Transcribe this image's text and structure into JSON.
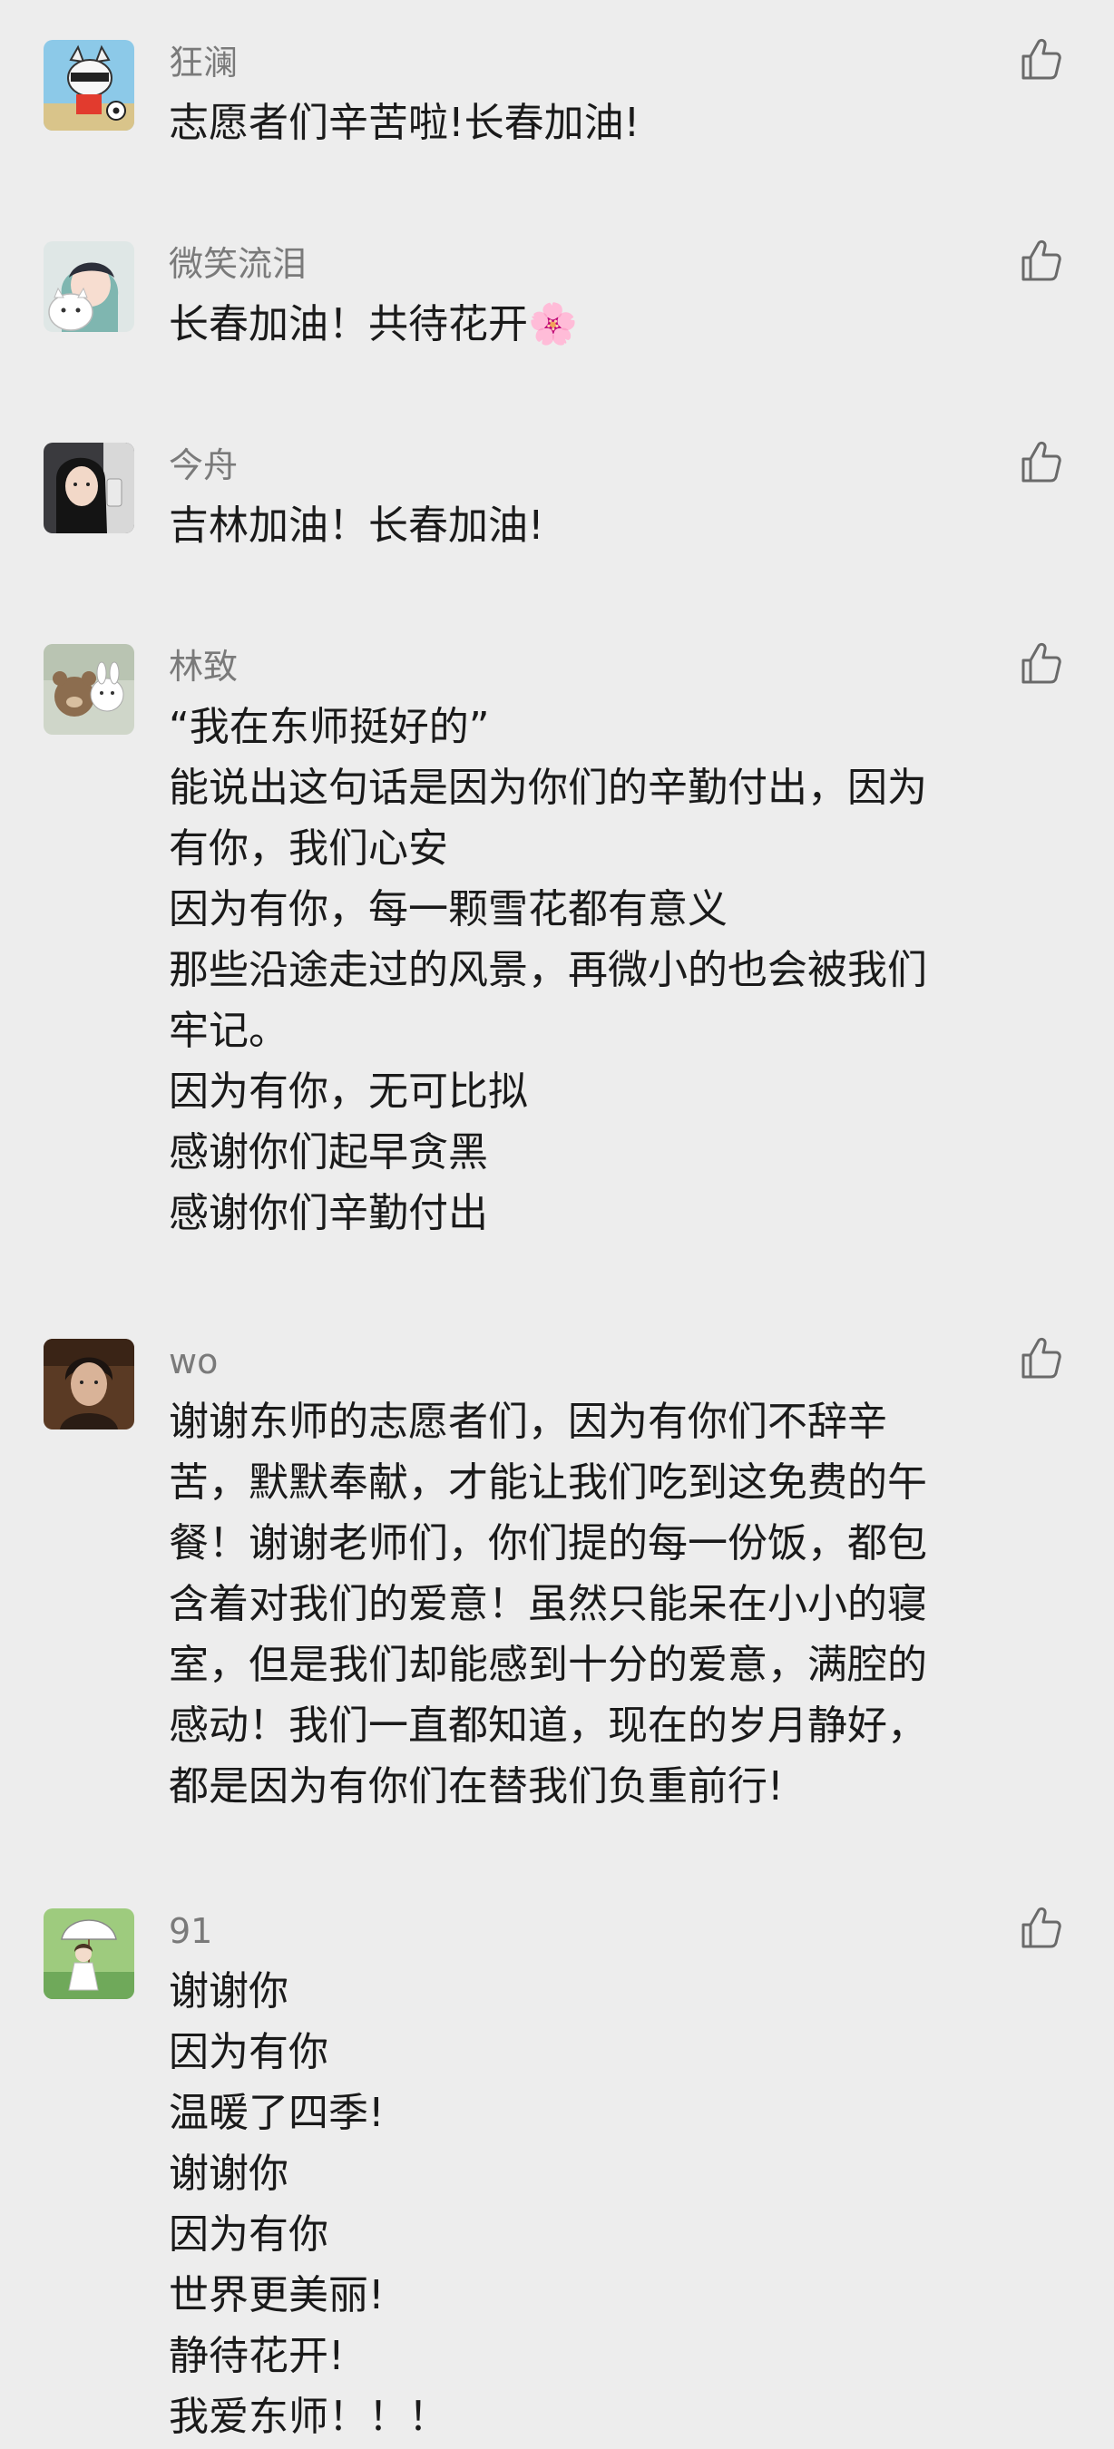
{
  "colors": {
    "background": "#ededed",
    "name": "#7a7a7a",
    "text": "#1a1a1a",
    "like_icon": "#6a6a6a"
  },
  "comments": [
    {
      "name": "狂澜",
      "lines": [
        "志愿者们辛苦啦!长春加油!"
      ],
      "avatar_icon": "cartoon-cat-soccer-avatar",
      "like_icon": "thumbs-up-icon"
    },
    {
      "name": "微笑流泪",
      "lines": [
        "长春加油！共待花开🌸"
      ],
      "avatar_icon": "girl-with-kitten-avatar",
      "like_icon": "thumbs-up-icon"
    },
    {
      "name": "今舟",
      "lines": [
        "吉林加油！长春加油!"
      ],
      "avatar_icon": "selfie-girl-avatar",
      "like_icon": "thumbs-up-icon"
    },
    {
      "name": "林致",
      "lines": [
        "“我在东师挺好的”",
        "能说出这句话是因为你们的辛勤付出，因为",
        "有你，我们心安",
        "因为有你，每一颗雪花都有意义",
        "那些沿途走过的风景，再微小的也会被我们",
        "牢记。",
        "因为有你，无可比拟",
        "感谢你们起早贪黑",
        "感谢你们辛勤付出"
      ],
      "avatar_icon": "cartoon-animals-avatar",
      "like_icon": "thumbs-up-icon"
    },
    {
      "name": "wo",
      "lines": [
        "谢谢东师的志愿者们，因为有你们不辞辛",
        "苦，默默奉献，才能让我们吃到这免费的午",
        "餐！谢谢老师们，你们提的每一份饭，都包",
        "含着对我们的爱意！虽然只能呆在小小的寝",
        "室，但是我们却能感到十分的爱意，满腔的",
        "感动！我们一直都知道，现在的岁月静好，",
        "都是因为有你们在替我们负重前行!"
      ],
      "avatar_icon": "man-portrait-avatar",
      "like_icon": "thumbs-up-icon"
    },
    {
      "name": "91",
      "lines": [
        "谢谢你",
        "因为有你",
        "温暖了四季!",
        "谢谢你",
        "因为有你",
        "世界更美丽!",
        "静待花开!",
        "我爱东师！！！"
      ],
      "avatar_icon": "anime-girl-umbrella-avatar",
      "like_icon": "thumbs-up-icon"
    }
  ]
}
